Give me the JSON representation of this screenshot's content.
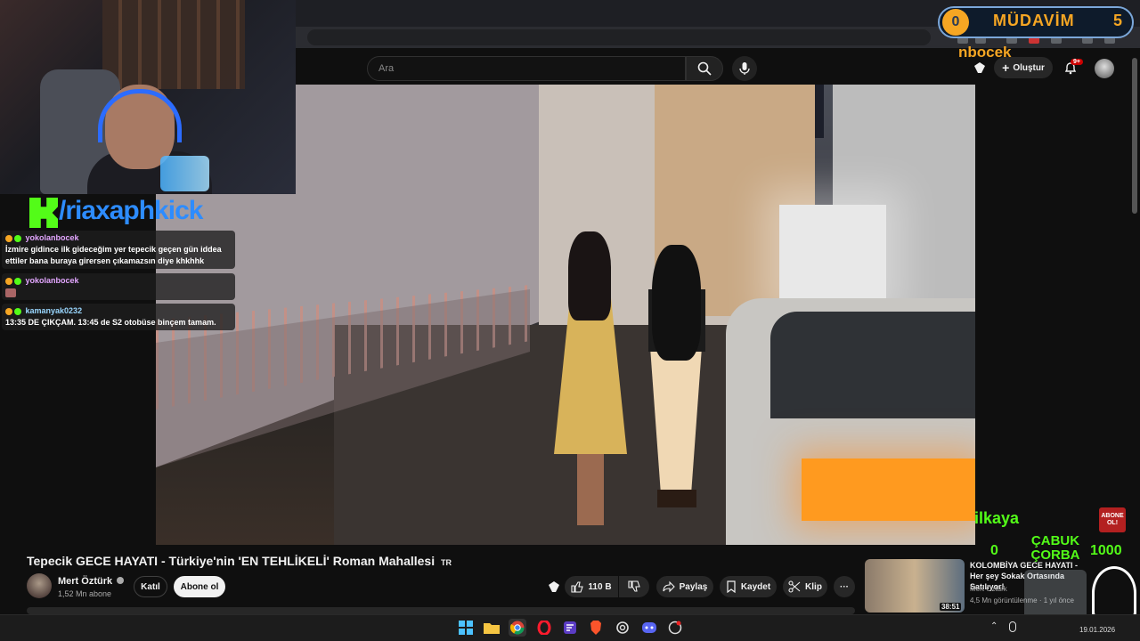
{
  "search": {
    "placeholder": "Ara"
  },
  "header": {
    "create_label": "Oluştur",
    "notification_badge": "9+"
  },
  "overlay": {
    "kick_handle": "/riaxaphkick",
    "mudavim_level": "0",
    "mudavim_label": "MÜDAVİM",
    "mudavim_count": "5",
    "follower_name": "nbocek",
    "sub_name": "ilkaya",
    "abone_badge": "ABONE OL!",
    "goal_current": "0",
    "goal_label": "ÇABUK ÇORBA",
    "goal_target": "1000"
  },
  "chat": [
    {
      "user": "yokolanbocek",
      "message": "İzmire gidince ilk gideceğim yer tepecik geçen gün iddea ettiler bana buraya girersen çıkamazsın diye khkhhk"
    },
    {
      "user": "yokolanbocek",
      "message": ""
    },
    {
      "user": "kamanyak0232",
      "message": "13:35 DE ÇIKÇAM. 13:45 de S2 otobüse binçem tamam."
    }
  ],
  "video": {
    "title": "Tepecik GECE HAYATI - Türkiye'nin 'EN TEHLİKELİ' Roman Mahallesi",
    "title_flag": "TR",
    "channel_name": "Mert Öztürk",
    "channel_subs": "1,52 Mn abone",
    "join_label": "Katıl",
    "subscribe_label": "Abone ol",
    "likes": "110 B",
    "share_label": "Paylaş",
    "save_label": "Kaydet",
    "clip_label": "Klip",
    "more_label": "···"
  },
  "recommended": {
    "title": "KOLOMBİYA GECE HAYATI - Her şey Sokak Ortasında Satılıyor!",
    "channel": "Mert Öztürk",
    "meta": "4,5 Mn görüntülenme · 1 yıl önce",
    "duration": "38:51"
  },
  "taskbar": {
    "date": "19.01.2026"
  },
  "colors": {
    "accent_green": "#53fc18",
    "accent_orange": "#f6a623",
    "yt_bg": "#0f0f0f"
  }
}
